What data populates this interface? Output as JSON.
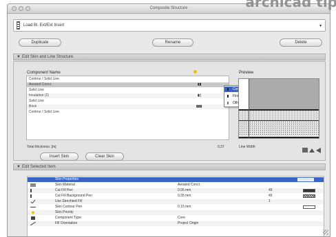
{
  "window": {
    "title": "Composite Structure",
    "watermark": "archicad tip"
  },
  "profile": {
    "name": "Load Bl. Ext/Ext Insert",
    "dropdown_glyph": "▾"
  },
  "buttons": {
    "duplicate": "Duplicate",
    "rename": "Rename",
    "delete": "Delete",
    "insert_skin": "Insert Skin",
    "clear_skin": "Clear Skin"
  },
  "section1": {
    "toggle": "▼",
    "label": "Edit Skin and Line Structure"
  },
  "components": {
    "header": "Component Name",
    "rows": [
      {
        "label": "Contour / Solid Line",
        "style": ""
      },
      {
        "label": "Aerated Concr.",
        "style": "sel"
      },
      {
        "label": "Solid Line",
        "style": ""
      },
      {
        "label": "Insulation (2)",
        "style": "alt"
      },
      {
        "label": "Solid Line",
        "style": ""
      },
      {
        "label": "Brick",
        "style": "alt"
      },
      {
        "label": "Contour / Solid Line",
        "style": ""
      }
    ]
  },
  "skin_type_menu": {
    "items": [
      "Core",
      "Finish",
      "Other"
    ],
    "selected": "Core"
  },
  "preview": {
    "label": "Preview"
  },
  "totals": {
    "label": "Total thickness: [m]",
    "value": "0,37",
    "line_width_label": "Line Width"
  },
  "section2": {
    "toggle": "▼",
    "label": "Edit Selected Item"
  },
  "properties": {
    "rows": [
      {
        "name": "Skin Properties",
        "value": "",
        "unit": "",
        "chip": "",
        "style": "sel"
      },
      {
        "name": "Skin Material",
        "value": "Aerated Concr.",
        "unit": "",
        "chip": "",
        "style": ""
      },
      {
        "name": "Cut Fill Pen",
        "value": "0.05 mm",
        "unit": "45",
        "chip": "dark",
        "style": "alt"
      },
      {
        "name": "Cut Fill Background Pen",
        "value": "0.35 mm",
        "unit": "45",
        "chip": "hatch",
        "style": ""
      },
      {
        "name": "Use Strechted Fill",
        "value": "",
        "unit": "1",
        "chip": "",
        "style": "alt"
      },
      {
        "name": "Skin Contour Pen",
        "value": "0.15 mm",
        "unit": "",
        "chip": "",
        "style": ""
      },
      {
        "name": "Skin Priority",
        "value": "",
        "unit": "",
        "chip": "",
        "style": "alt"
      },
      {
        "name": "Component Type",
        "value": "Core",
        "unit": "",
        "chip": "",
        "style": ""
      },
      {
        "name": "Fill Orientation",
        "value": "Project Origin",
        "unit": "",
        "chip": "",
        "style": "alt"
      }
    ]
  },
  "colors": {
    "selection": "#3a63c8",
    "window_bg": "#e9e9e9",
    "watermark": "#8a8a8a"
  }
}
